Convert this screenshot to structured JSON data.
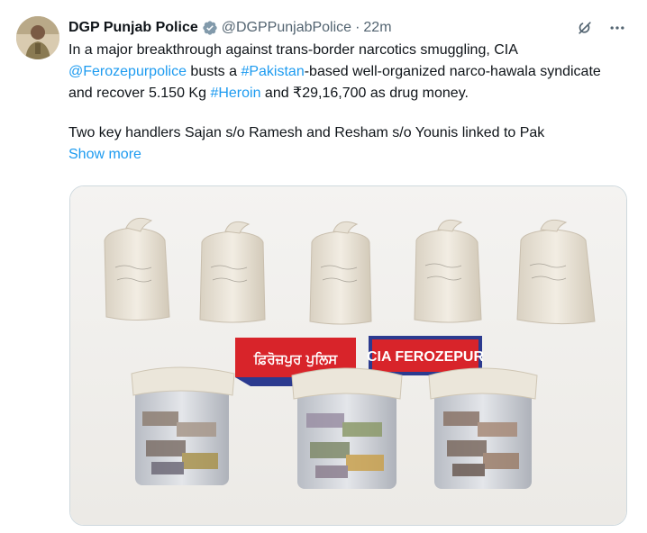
{
  "tweet": {
    "author_name": "DGP Punjab Police",
    "author_handle": "@DGPPunjabPolice",
    "separator": "·",
    "time": "22m",
    "text_part1": "In a major breakthrough against trans-border narcotics smuggling, CIA ",
    "mention": "@Ferozepurpolice",
    "text_part2": " busts a ",
    "hashtag1": "#Pakistan",
    "text_part3": "-based well-organized narco-hawala syndicate and recover 5.150 Kg ",
    "hashtag2": "#Heroin",
    "text_part4": " and ₹29,16,700 as drug money.",
    "text_para2": "Two key handlers Sajan s/o Ramesh and Resham s/o Younis linked to Pak",
    "show_more": "Show more"
  },
  "media": {
    "sign_left": "ਫ਼ਿਰੋਜ਼ਪੁਰ ਪੁਲਿਸ",
    "sign_right": "CIA FEROZEPUR"
  },
  "icons": {
    "verified": "verified-badge-icon",
    "grok": "grok-icon",
    "more": "more-options-icon"
  },
  "colors": {
    "link": "#1d9bf0",
    "secondary_text": "#536471",
    "sign_red": "#d8242a",
    "sign_blue": "#2b3a8f"
  }
}
